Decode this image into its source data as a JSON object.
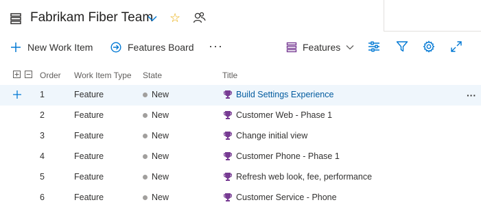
{
  "header": {
    "team_name": "Fabrikam Fiber Team"
  },
  "toolbar": {
    "new_work_item": "New Work Item",
    "features_board": "Features Board",
    "more": "···",
    "backlog_level": "Features"
  },
  "columns": {
    "order": "Order",
    "work_item_type": "Work Item Type",
    "state": "State",
    "title": "Title"
  },
  "rows": [
    {
      "order": "1",
      "type": "Feature",
      "state": "New",
      "title": "Build Settings Experience",
      "selected": true
    },
    {
      "order": "2",
      "type": "Feature",
      "state": "New",
      "title": "Customer Web - Phase 1"
    },
    {
      "order": "3",
      "type": "Feature",
      "state": "New",
      "title": "Change initial view"
    },
    {
      "order": "4",
      "type": "Feature",
      "state": "New",
      "title": "Customer Phone - Phase 1"
    },
    {
      "order": "5",
      "type": "Feature",
      "state": "New",
      "title": "Refresh web look, fee, performance"
    },
    {
      "order": "6",
      "type": "Feature",
      "state": "New",
      "title": "Customer Service - Phone"
    }
  ],
  "row_more": "···",
  "colors": {
    "accent": "#0078d4",
    "link": "#005a9e",
    "trophy": "#773b93",
    "star": "#e8a900",
    "state_new": "#a19f9d",
    "selected_row": "#eff6fc"
  },
  "icons": {
    "backlog": "backlog-icon",
    "favorite": "star-icon",
    "team_members": "people-icon",
    "add": "plus-icon",
    "board": "arrow-circle-icon",
    "settings": "sliders-icon",
    "filter": "filter-icon",
    "gear": "gear-icon",
    "fullscreen": "expand-icon",
    "work_item": "trophy-icon"
  }
}
